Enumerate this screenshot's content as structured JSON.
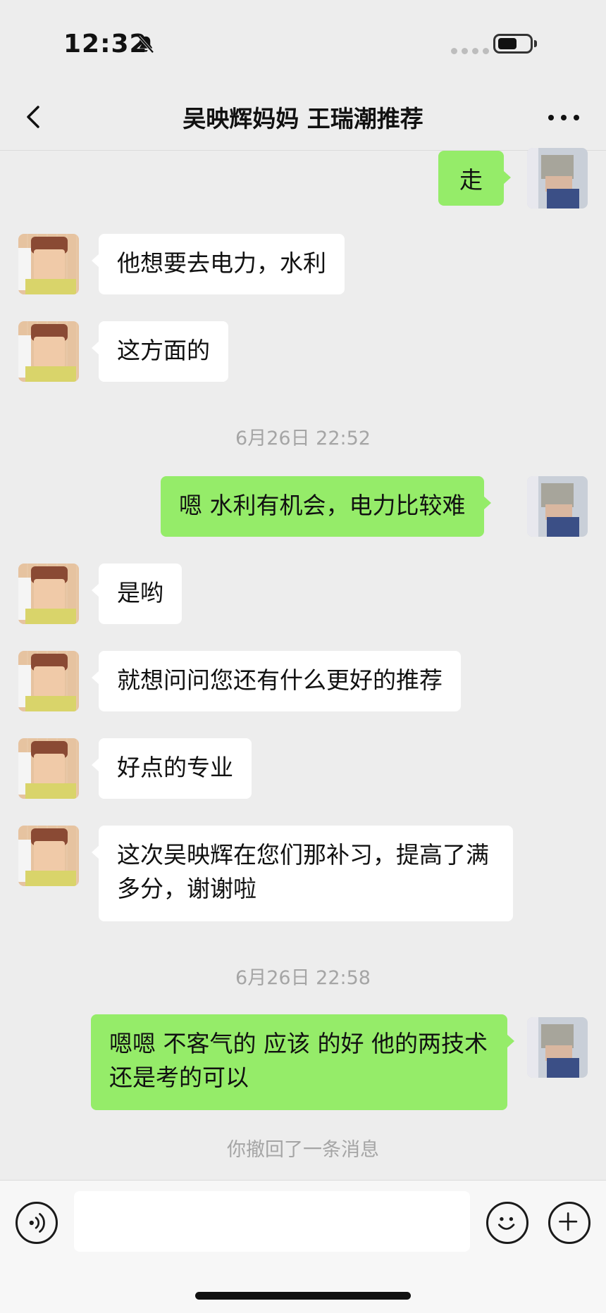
{
  "status": {
    "time": "12:32"
  },
  "header": {
    "title": "吴映辉妈妈 王瑞潮推荐"
  },
  "messages": [
    {
      "side": "right",
      "text": "走"
    },
    {
      "side": "left",
      "text": "他想要去电力，水利"
    },
    {
      "side": "left",
      "text": "这方面的"
    },
    {
      "side": "time",
      "text": "6月26日 22:52"
    },
    {
      "side": "right",
      "text": "嗯 水利有机会，电力比较难"
    },
    {
      "side": "left",
      "text": "是哟"
    },
    {
      "side": "left",
      "text": "就想问问您还有什么更好的推荐"
    },
    {
      "side": "left",
      "text": "好点的专业"
    },
    {
      "side": "left",
      "text": "这次吴映辉在您们那补习，提高了满多分，谢谢啦"
    },
    {
      "side": "time",
      "text": "6月26日 22:58"
    },
    {
      "side": "right",
      "text": "嗯嗯 不客气的 应该 的好 他的两技术还是考的可以"
    }
  ],
  "recall_notice": "你撤回了一条消息",
  "input": {
    "value": ""
  },
  "icons": {
    "back": "chevron-left-icon",
    "more": "more-dots-icon",
    "voice": "voice-icon",
    "emoji": "emoji-icon",
    "plus": "plus-icon",
    "bell": "bell-muted-icon"
  }
}
